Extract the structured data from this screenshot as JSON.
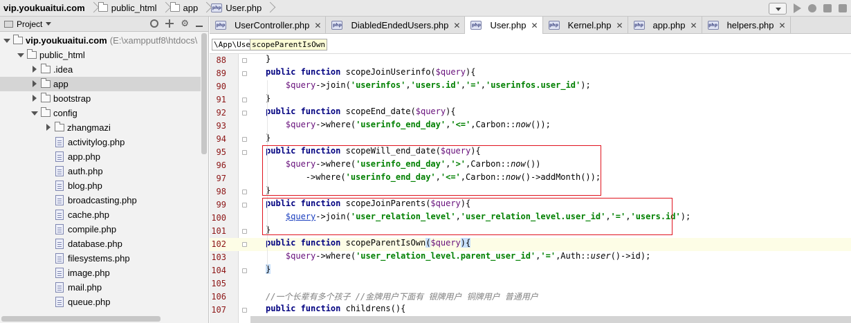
{
  "navbar": {
    "crumbs": [
      "vip.youkuaitui.com",
      "public_html",
      "app",
      "User.php"
    ]
  },
  "project_panel": {
    "title": "Project",
    "tree": [
      {
        "label": "vip.youkuaitui.com",
        "extra": "(E:\\xampputf8\\htdocs\\",
        "type": "folder",
        "state": "open",
        "depth": 0
      },
      {
        "label": "public_html",
        "type": "folder",
        "state": "open",
        "depth": 1
      },
      {
        "label": ".idea",
        "type": "folder",
        "state": "closed",
        "depth": 2
      },
      {
        "label": "app",
        "type": "folder",
        "state": "closed",
        "depth": 2,
        "selected": true
      },
      {
        "label": "bootstrap",
        "type": "folder",
        "state": "closed",
        "depth": 2
      },
      {
        "label": "config",
        "type": "folder",
        "state": "open",
        "depth": 2
      },
      {
        "label": "zhangmazi",
        "type": "folder",
        "state": "closed",
        "depth": 3
      },
      {
        "label": "activitylog.php",
        "type": "file",
        "depth": 3
      },
      {
        "label": "app.php",
        "type": "file",
        "depth": 3
      },
      {
        "label": "auth.php",
        "type": "file",
        "depth": 3
      },
      {
        "label": "blog.php",
        "type": "file",
        "depth": 3
      },
      {
        "label": "broadcasting.php",
        "type": "file",
        "depth": 3
      },
      {
        "label": "cache.php",
        "type": "file",
        "depth": 3
      },
      {
        "label": "compile.php",
        "type": "file",
        "depth": 3
      },
      {
        "label": "database.php",
        "type": "file",
        "depth": 3
      },
      {
        "label": "filesystems.php",
        "type": "file",
        "depth": 3
      },
      {
        "label": "image.php",
        "type": "file",
        "depth": 3
      },
      {
        "label": "mail.php",
        "type": "file",
        "depth": 3
      },
      {
        "label": "queue.php",
        "type": "file",
        "depth": 3
      }
    ]
  },
  "tabs": [
    {
      "label": "UserController.php",
      "active": false
    },
    {
      "label": "DiabledEndedUsers.php",
      "active": false
    },
    {
      "label": "User.php",
      "active": true
    },
    {
      "label": "Kernel.php",
      "active": false
    },
    {
      "label": "app.php",
      "active": false
    },
    {
      "label": "helpers.php",
      "active": false
    }
  ],
  "editor_breadcrumb": {
    "namespace": "\\App\\User",
    "method": "scopeParentIsOwn"
  },
  "code_lines": [
    {
      "n": "88",
      "html": "}"
    },
    {
      "n": "89",
      "html": "<span class=\"kw\">public function</span> scopeJoinUserinfo(<span class=\"var\">$query</span>){"
    },
    {
      "n": "90",
      "html": "    <span class=\"var\">$query</span>-&gt;join(<span class=\"str\">'userinfos'</span>,<span class=\"str\">'users.id'</span>,<span class=\"str\">'='</span>,<span class=\"str\">'userinfos.user_id'</span>);"
    },
    {
      "n": "91",
      "html": "}"
    },
    {
      "n": "92",
      "html": "<span class=\"kw\">public function</span> scopeEnd_date(<span class=\"var\">$query</span>){"
    },
    {
      "n": "93",
      "html": "    <span class=\"var\">$query</span>-&gt;where(<span class=\"str\">'userinfo_end_day'</span>,<span class=\"str\">'&lt;='</span>,Carbon::<i>now</i>());"
    },
    {
      "n": "94",
      "html": "}"
    },
    {
      "n": "95",
      "html": "<span class=\"kw\">public function</span> scopeWill_end_date(<span class=\"var\">$query</span>){"
    },
    {
      "n": "96",
      "html": "    <span class=\"var\">$query</span>-&gt;where(<span class=\"str\">'userinfo_end_day'</span>,<span class=\"str\">'&gt;'</span>,Carbon::<i>now</i>())"
    },
    {
      "n": "97",
      "html": "        -&gt;where(<span class=\"str\">'userinfo_end_day'</span>,<span class=\"str\">'&lt;='</span>,Carbon::<i>now</i>()-&gt;addMonth());"
    },
    {
      "n": "98",
      "html": "}"
    },
    {
      "n": "99",
      "html": "<span class=\"kw\">public function</span> scopeJoinParents(<span class=\"var\">$query</span>){"
    },
    {
      "n": "100",
      "html": "    <span class=\"lnk\">$query</span>-&gt;join(<span class=\"str\">'user_relation_level'</span>,<span class=\"str\">'user_relation_level.user_id'</span>,<span class=\"str\">'='</span>,<span class=\"str\">'users.id'</span>);"
    },
    {
      "n": "101",
      "html": "}"
    },
    {
      "n": "102",
      "html": "<span class=\"kw\">public function</span> scopeParentIsOwn<span class=\"hl\">(</span><span class=\"var\">$query</span><span class=\"hl\">){</span>"
    },
    {
      "n": "103",
      "html": "    <span class=\"var\">$query</span>-&gt;where(<span class=\"str\">'user_relation_level.parent_user_id'</span>,<span class=\"str\">'='</span>,Auth::<i>user</i>()-&gt;id);"
    },
    {
      "n": "104",
      "html": "<span class=\"hl\">}</span>"
    },
    {
      "n": "105",
      "html": ""
    },
    {
      "n": "106",
      "html": "<span class=\"cmt\">//一个长辈有多个孩子 //金牌用户下面有 银牌用户 铜牌用户 普通用户</span>"
    },
    {
      "n": "107",
      "html": "<span class=\"kw\">public function</span> childrens(){"
    }
  ]
}
